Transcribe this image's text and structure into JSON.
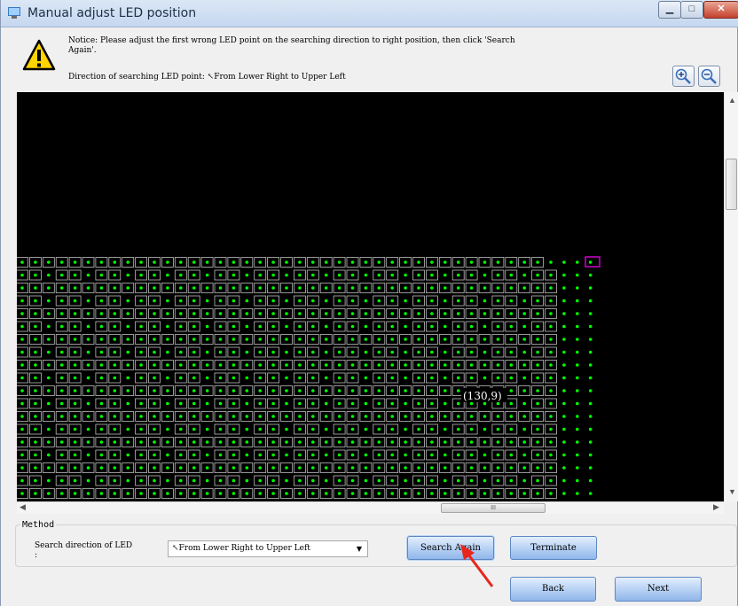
{
  "window": {
    "title": "Manual adjust LED position",
    "min_glyph": "▁",
    "max_glyph": "□",
    "close_glyph": "✕"
  },
  "notice": {
    "text": "Notice: Please adjust the first wrong LED point on the searching direction to right position, then click 'Search\nAgain'.",
    "direction": "Direction of searching LED point: ↖From Lower Right to Upper Left",
    "icon": "warning-icon"
  },
  "zoom": {
    "in_icon": "zoom-in-icon",
    "out_icon": "zoom-out-icon"
  },
  "grid": {
    "coordinate_label": "(130,9)",
    "led_color": "#00ff00",
    "box_color": "#bcbcbc",
    "highlight_color": "#ff00ff",
    "rows": 19,
    "columns": 44
  },
  "scrollbars": {
    "hscroll_thumb_grip": "III"
  },
  "method": {
    "legend": "Method",
    "search_direction_label": "Search direction of LED\n:",
    "selected_direction": "↖From Lower Right to Upper Left"
  },
  "buttons": {
    "search_again": "Search Again",
    "terminate": "Terminate",
    "back": "Back",
    "next": "Next"
  }
}
